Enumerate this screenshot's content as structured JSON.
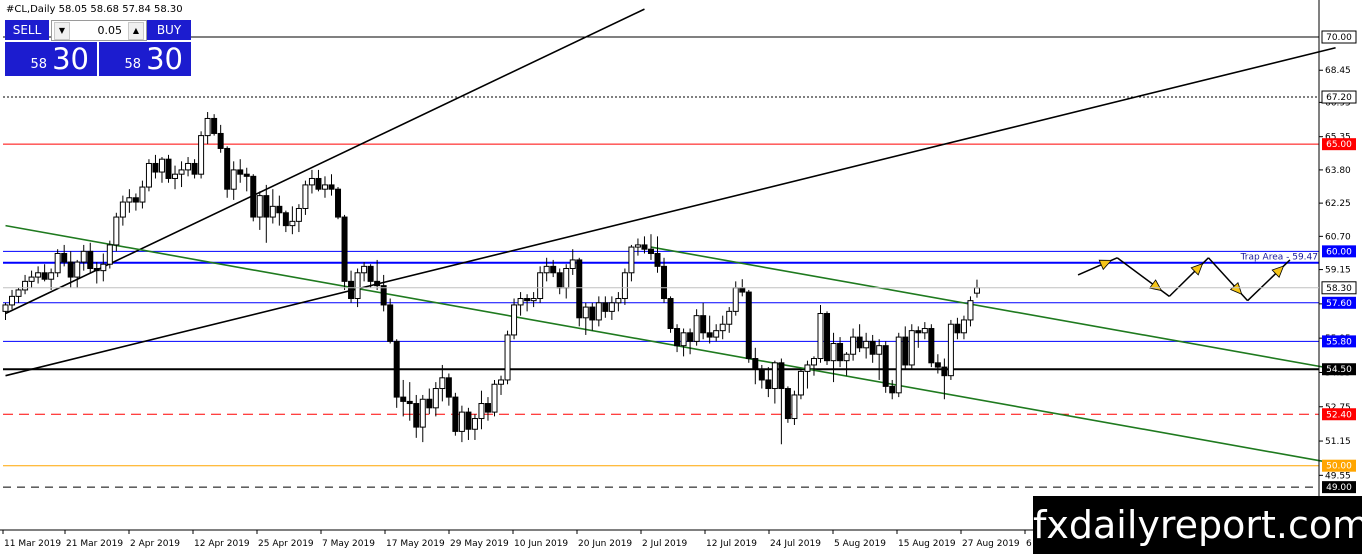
{
  "header": {
    "symbol_info": "#CL,Daily  58.05 58.68 57.84 58.30"
  },
  "trade_panel": {
    "sell_label": "SELL",
    "buy_label": "BUY",
    "lot_value": "0.05",
    "sell_price_small": "58",
    "sell_price_big": "30",
    "buy_price_small": "58",
    "buy_price_big": "30"
  },
  "watermark": "fxdailyreport.com",
  "colors": {
    "blue_panel": "#1c1ccf",
    "red_tag": "#ff0000",
    "blue_tag": "#0000ff",
    "black_tag": "#000000",
    "green_channel": "#1f7a1f",
    "orange_tag": "#ffa500",
    "arrow_fill": "#f5c518"
  },
  "chart_data": {
    "type": "candlestick",
    "symbol": "#CL",
    "timeframe": "Daily",
    "ohlc_last": {
      "open": 58.05,
      "high": 58.68,
      "low": 57.84,
      "close": 58.3
    },
    "ylim": [
      47.0,
      71.4
    ],
    "y_ticks": [
      49.55,
      51.15,
      52.75,
      54.35,
      55.95,
      57.55,
      59.15,
      60.7,
      62.25,
      63.8,
      65.35,
      66.95,
      68.45
    ],
    "x_tick_labels": [
      "11 Mar 2019",
      "21 Mar 2019",
      "2 Apr 2019",
      "12 Apr 2019",
      "25 Apr 2019",
      "7 May 2019",
      "17 May 2019",
      "29 May 2019",
      "10 Jun 2019",
      "20 Jun 2019",
      "2 Jul 2019",
      "12 Jul 2019",
      "24 Jul 2019",
      "5 Aug 2019",
      "15 Aug 2019",
      "27 Aug 2019",
      "6"
    ],
    "current_price_label": "58.30",
    "trap_area_label": "Trap Area - 59.47",
    "levels": [
      {
        "value": 70.0,
        "label": "70.00",
        "color": "#000000",
        "style": "solid"
      },
      {
        "value": 67.2,
        "label": "67.20",
        "color": "#000000",
        "style": "dotted"
      },
      {
        "value": 65.0,
        "label": "65.00",
        "color": "#ff0000",
        "style": "solid",
        "tag": "#ff0000"
      },
      {
        "value": 60.0,
        "label": "60.00",
        "color": "#0000ff",
        "style": "solid",
        "tag": "#0000ff"
      },
      {
        "value": 59.47,
        "label": "",
        "color": "#0000ff",
        "style": "solid-thick"
      },
      {
        "value": 57.6,
        "label": "57.60",
        "color": "#0000ff",
        "style": "solid",
        "tag": "#0000ff"
      },
      {
        "value": 55.8,
        "label": "55.80",
        "color": "#0000ff",
        "style": "solid",
        "tag": "#0000ff"
      },
      {
        "value": 54.5,
        "label": "54.50",
        "color": "#000000",
        "style": "solid-thick",
        "tag": "#000000"
      },
      {
        "value": 52.4,
        "label": "52.40",
        "color": "#ff0000",
        "style": "dashed",
        "tag": "#ff0000"
      },
      {
        "value": 50.0,
        "label": "50.00",
        "color": "#ffa500",
        "style": "solid",
        "tag": "#ffa500"
      },
      {
        "value": 49.0,
        "label": "49.00",
        "color": "#000000",
        "style": "dashed",
        "tag": "#000000"
      }
    ],
    "candles": [
      [
        57.2,
        57.6,
        56.8,
        57.5
      ],
      [
        57.5,
        58.2,
        57.3,
        57.9
      ],
      [
        57.9,
        58.3,
        57.6,
        58.2
      ],
      [
        58.2,
        58.9,
        58.0,
        58.6
      ],
      [
        58.6,
        59.1,
        58.3,
        58.8
      ],
      [
        58.8,
        59.3,
        58.5,
        59.0
      ],
      [
        59.0,
        59.4,
        58.6,
        58.7
      ],
      [
        58.7,
        59.2,
        58.2,
        59.0
      ],
      [
        59.0,
        60.1,
        58.8,
        59.9
      ],
      [
        59.9,
        60.3,
        59.3,
        59.5
      ],
      [
        59.5,
        60.0,
        58.3,
        58.8
      ],
      [
        58.8,
        59.6,
        58.3,
        59.5
      ],
      [
        59.5,
        60.3,
        59.1,
        60.0
      ],
      [
        60.0,
        60.4,
        59.0,
        59.2
      ],
      [
        59.2,
        59.5,
        58.5,
        59.1
      ],
      [
        59.1,
        59.9,
        58.6,
        59.4
      ],
      [
        59.4,
        60.5,
        59.2,
        60.3
      ],
      [
        60.3,
        61.8,
        60.0,
        61.6
      ],
      [
        61.6,
        62.6,
        61.2,
        62.3
      ],
      [
        62.3,
        62.9,
        61.8,
        62.5
      ],
      [
        62.5,
        62.7,
        61.9,
        62.3
      ],
      [
        62.3,
        63.3,
        62.0,
        63.0
      ],
      [
        63.0,
        64.3,
        62.8,
        64.1
      ],
      [
        64.1,
        64.5,
        63.4,
        63.7
      ],
      [
        63.7,
        64.4,
        63.2,
        64.3
      ],
      [
        64.3,
        64.5,
        63.2,
        63.4
      ],
      [
        63.4,
        64.0,
        62.9,
        63.6
      ],
      [
        63.6,
        64.2,
        63.0,
        63.8
      ],
      [
        63.8,
        64.4,
        63.5,
        64.1
      ],
      [
        64.1,
        64.3,
        63.4,
        63.6
      ],
      [
        63.6,
        65.6,
        63.4,
        65.4
      ],
      [
        65.4,
        66.5,
        65.0,
        66.2
      ],
      [
        66.2,
        66.4,
        65.4,
        65.5
      ],
      [
        65.5,
        65.9,
        64.6,
        64.8
      ],
      [
        64.8,
        64.9,
        62.5,
        62.9
      ],
      [
        62.9,
        64.2,
        62.4,
        63.8
      ],
      [
        63.8,
        64.3,
        63.2,
        63.6
      ],
      [
        63.6,
        63.9,
        62.8,
        63.5
      ],
      [
        63.5,
        63.6,
        61.4,
        61.6
      ],
      [
        61.6,
        62.8,
        61.0,
        62.6
      ],
      [
        62.6,
        63.1,
        60.4,
        61.6
      ],
      [
        61.6,
        62.9,
        61.3,
        62.1
      ],
      [
        62.1,
        62.6,
        61.2,
        61.8
      ],
      [
        61.8,
        61.9,
        60.9,
        61.2
      ],
      [
        61.2,
        62.1,
        60.8,
        61.4
      ],
      [
        61.4,
        62.2,
        60.9,
        62.0
      ],
      [
        62.0,
        63.3,
        61.7,
        63.1
      ],
      [
        63.1,
        63.8,
        62.7,
        63.4
      ],
      [
        63.4,
        63.8,
        62.8,
        62.9
      ],
      [
        62.9,
        63.5,
        62.5,
        63.1
      ],
      [
        63.1,
        63.6,
        62.6,
        62.9
      ],
      [
        62.9,
        63.0,
        61.5,
        61.6
      ],
      [
        61.6,
        61.7,
        58.2,
        58.6
      ],
      [
        58.6,
        59.1,
        57.6,
        57.8
      ],
      [
        57.8,
        59.2,
        57.4,
        59.0
      ],
      [
        59.0,
        59.5,
        58.6,
        59.3
      ],
      [
        59.3,
        59.4,
        58.3,
        58.6
      ],
      [
        58.6,
        59.6,
        58.2,
        58.4
      ],
      [
        58.4,
        58.9,
        57.2,
        57.5
      ],
      [
        57.5,
        57.8,
        55.7,
        55.8
      ],
      [
        55.8,
        55.9,
        52.7,
        53.2
      ],
      [
        53.2,
        54.0,
        52.3,
        53.0
      ],
      [
        53.0,
        53.9,
        52.1,
        52.9
      ],
      [
        52.9,
        53.3,
        51.3,
        51.8
      ],
      [
        51.8,
        53.3,
        51.1,
        53.1
      ],
      [
        53.1,
        53.6,
        52.4,
        52.7
      ],
      [
        52.7,
        53.9,
        52.3,
        53.6
      ],
      [
        53.6,
        54.7,
        53.0,
        54.1
      ],
      [
        54.1,
        54.3,
        52.8,
        53.2
      ],
      [
        53.2,
        53.4,
        51.4,
        51.6
      ],
      [
        51.6,
        52.8,
        51.1,
        52.5
      ],
      [
        52.5,
        52.7,
        51.2,
        51.7
      ],
      [
        51.7,
        52.4,
        51.2,
        52.2
      ],
      [
        52.2,
        53.5,
        51.7,
        52.9
      ],
      [
        52.9,
        53.2,
        52.1,
        52.5
      ],
      [
        52.5,
        54.0,
        52.3,
        53.8
      ],
      [
        53.8,
        54.2,
        53.3,
        54.0
      ],
      [
        54.0,
        56.3,
        53.8,
        56.1
      ],
      [
        56.1,
        57.8,
        55.9,
        57.5
      ],
      [
        57.5,
        58.1,
        57.0,
        57.8
      ],
      [
        57.8,
        58.0,
        57.2,
        57.7
      ],
      [
        57.7,
        58.1,
        57.4,
        57.8
      ],
      [
        57.8,
        59.3,
        57.6,
        59.0
      ],
      [
        59.0,
        59.7,
        58.6,
        59.3
      ],
      [
        59.3,
        59.6,
        58.8,
        59.0
      ],
      [
        59.0,
        59.2,
        58.0,
        58.3
      ],
      [
        58.3,
        59.4,
        57.8,
        59.2
      ],
      [
        59.2,
        60.1,
        58.9,
        59.6
      ],
      [
        59.6,
        59.7,
        56.5,
        56.9
      ],
      [
        56.9,
        57.6,
        56.1,
        57.4
      ],
      [
        57.4,
        57.6,
        56.3,
        56.8
      ],
      [
        56.8,
        57.9,
        56.5,
        57.6
      ],
      [
        57.6,
        57.9,
        56.9,
        57.2
      ],
      [
        57.2,
        57.9,
        56.8,
        57.6
      ],
      [
        57.6,
        58.1,
        57.2,
        57.8
      ],
      [
        57.8,
        59.2,
        57.5,
        59.0
      ],
      [
        59.0,
        60.3,
        58.6,
        60.2
      ],
      [
        60.2,
        60.6,
        59.8,
        60.3
      ],
      [
        60.3,
        60.7,
        59.9,
        60.1
      ],
      [
        60.1,
        60.8,
        59.6,
        59.9
      ],
      [
        59.9,
        60.7,
        59.0,
        59.3
      ],
      [
        59.3,
        59.7,
        57.6,
        57.8
      ],
      [
        57.8,
        57.9,
        56.2,
        56.4
      ],
      [
        56.4,
        56.6,
        55.3,
        55.6
      ],
      [
        55.6,
        56.4,
        55.1,
        56.2
      ],
      [
        56.2,
        56.4,
        55.2,
        55.8
      ],
      [
        55.8,
        57.3,
        55.6,
        57.0
      ],
      [
        57.0,
        57.6,
        55.9,
        56.2
      ],
      [
        56.2,
        57.0,
        55.7,
        56.0
      ],
      [
        56.0,
        56.6,
        55.8,
        56.3
      ],
      [
        56.3,
        57.0,
        55.9,
        56.6
      ],
      [
        56.6,
        57.4,
        56.2,
        57.2
      ],
      [
        57.2,
        58.6,
        57.0,
        58.3
      ],
      [
        58.3,
        58.7,
        57.9,
        58.1
      ],
      [
        58.1,
        58.2,
        54.8,
        55.0
      ],
      [
        55.0,
        55.5,
        53.8,
        54.5
      ],
      [
        54.5,
        54.7,
        53.6,
        54.0
      ],
      [
        54.0,
        54.6,
        53.2,
        53.6
      ],
      [
        53.6,
        54.9,
        52.9,
        54.8
      ],
      [
        54.8,
        55.0,
        51.0,
        53.6
      ],
      [
        53.6,
        53.7,
        52.0,
        52.2
      ],
      [
        52.2,
        53.5,
        51.9,
        53.3
      ],
      [
        53.3,
        54.5,
        53.1,
        54.4
      ],
      [
        54.4,
        54.9,
        53.6,
        54.7
      ],
      [
        54.7,
        55.1,
        54.2,
        55.0
      ],
      [
        55.0,
        57.5,
        54.8,
        57.1
      ],
      [
        57.1,
        57.2,
        54.7,
        54.9
      ],
      [
        54.9,
        56.2,
        53.9,
        55.7
      ],
      [
        55.7,
        56.0,
        54.6,
        54.9
      ],
      [
        54.9,
        55.3,
        54.2,
        55.2
      ],
      [
        55.2,
        56.4,
        54.9,
        56.0
      ],
      [
        56.0,
        56.6,
        55.3,
        55.5
      ],
      [
        55.5,
        56.2,
        55.0,
        55.8
      ],
      [
        55.8,
        56.1,
        54.8,
        55.2
      ],
      [
        55.2,
        55.9,
        54.0,
        55.6
      ],
      [
        55.6,
        55.8,
        53.4,
        53.7
      ],
      [
        53.7,
        54.0,
        53.1,
        53.4
      ],
      [
        53.4,
        56.2,
        53.2,
        56.0
      ],
      [
        56.0,
        56.5,
        54.5,
        54.7
      ],
      [
        54.7,
        56.6,
        54.5,
        56.3
      ],
      [
        56.3,
        56.5,
        55.5,
        56.2
      ],
      [
        56.2,
        56.7,
        55.9,
        56.4
      ],
      [
        56.4,
        56.6,
        54.6,
        54.8
      ],
      [
        54.8,
        55.2,
        54.3,
        54.6
      ],
      [
        54.6,
        55.0,
        53.1,
        54.2
      ],
      [
        54.2,
        56.8,
        54.0,
        56.6
      ],
      [
        56.6,
        56.9,
        55.9,
        56.2
      ],
      [
        56.2,
        57.0,
        55.9,
        56.8
      ],
      [
        56.8,
        57.9,
        56.5,
        57.7
      ],
      [
        58.05,
        58.68,
        57.84,
        58.3
      ]
    ],
    "trendlines": [
      {
        "name": "",
        "color": "#000000",
        "from": [
          0,
          57.1
        ],
        "to": [
          98,
          71.3
        ]
      },
      {
        "name": "",
        "color": "#000000",
        "from": [
          0,
          54.2
        ],
        "to": [
          204,
          69.5
        ]
      },
      {
        "name": "",
        "color": "#1f7a1f",
        "from": [
          0,
          61.2
        ],
        "to": [
          204,
          50.1
        ]
      },
      {
        "name": "",
        "color": "#1f7a1f",
        "from": [
          99,
          60.2
        ],
        "to": [
          204,
          54.5
        ]
      }
    ],
    "projection_path": [
      [
        164.5,
        58.9
      ],
      [
        170.5,
        59.7
      ],
      [
        178.5,
        57.9
      ],
      [
        184.5,
        59.7
      ],
      [
        190.5,
        57.7
      ],
      [
        197,
        59.6
      ]
    ]
  }
}
